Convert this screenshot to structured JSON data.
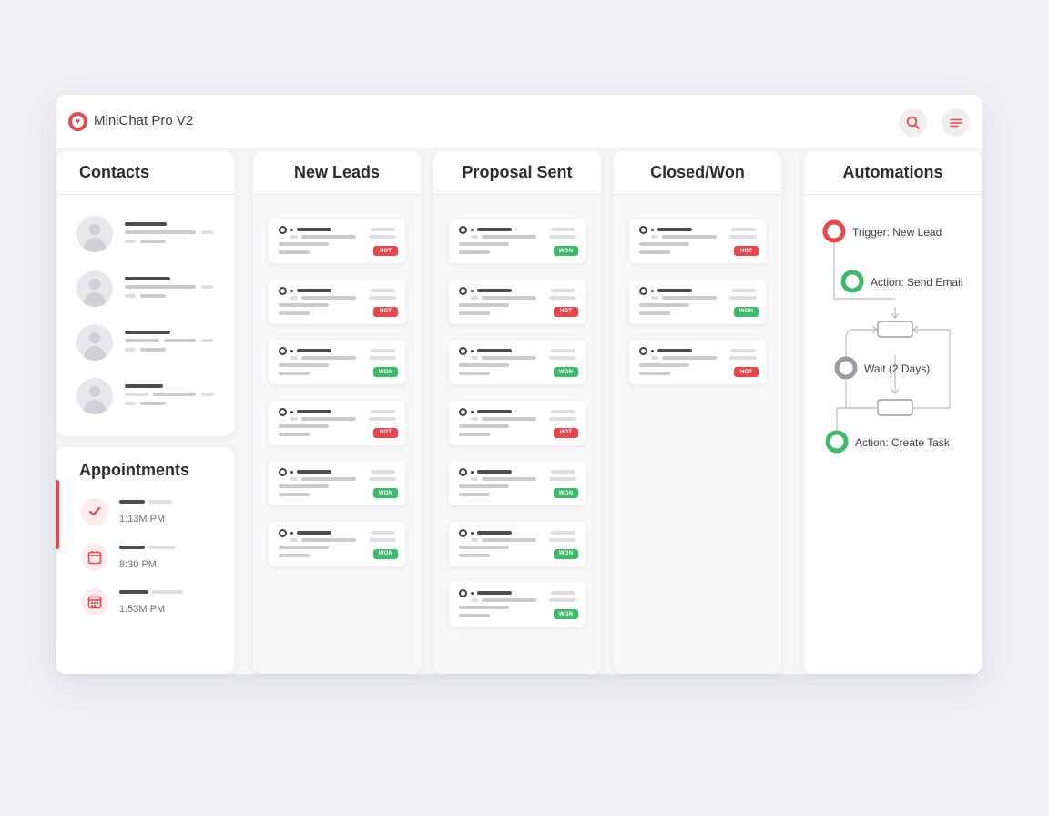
{
  "app": {
    "title": "MiniChat Pro V2"
  },
  "toolbar": {
    "search_icon": "search-icon",
    "menu_icon": "menu-icon"
  },
  "contacts": {
    "title": "Contacts",
    "count_shown": 4
  },
  "appointments": {
    "title": "Appointments",
    "items": [
      {
        "icon": "check-icon",
        "time": "1:13M PM"
      },
      {
        "icon": "calendar-icon",
        "time": "8:30 PM"
      },
      {
        "icon": "calendar-grid-icon",
        "time": "1:53M PM"
      }
    ]
  },
  "pipeline": {
    "columns": [
      {
        "title": "New Leads",
        "cards": [
          "HOT",
          "HOT",
          "WON",
          "HOT",
          "WON",
          "WON"
        ]
      },
      {
        "title": "Proposal Sent",
        "cards": [
          "WON",
          "HOT",
          "WON",
          "HOT",
          "WON",
          "WON",
          "WON"
        ]
      },
      {
        "title": "Closed/Won",
        "cards": [
          "HOT",
          "WON",
          "HOT"
        ]
      }
    ]
  },
  "automations": {
    "title": "Automations",
    "nodes": [
      {
        "label": "Trigger: New Lead",
        "status": "trigger"
      },
      {
        "label": "Action: Send Email",
        "status": "action"
      },
      {
        "label": "Wait (2 Days)",
        "status": "wait"
      },
      {
        "label": "Action: Create Task",
        "status": "action"
      }
    ]
  },
  "colors": {
    "accent": "#e8474c",
    "success": "#3dba6a",
    "neutral": "#9a9ca3"
  }
}
